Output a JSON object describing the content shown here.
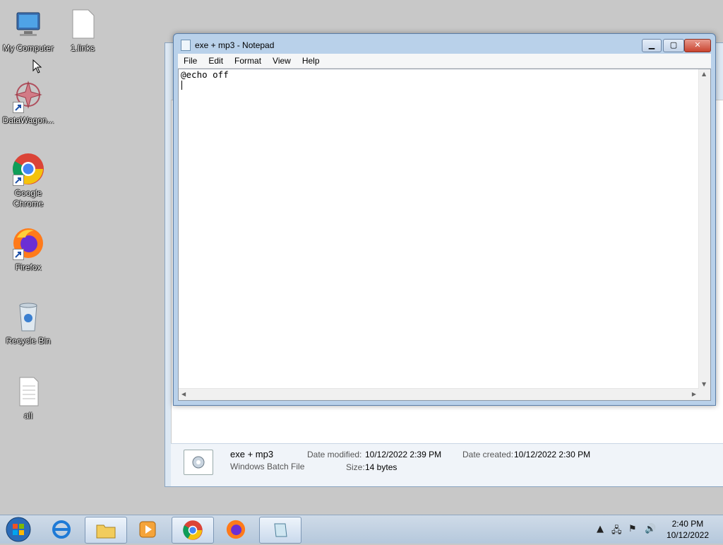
{
  "desktop": {
    "icons": [
      {
        "label": "My Computer"
      },
      {
        "label": "1.links"
      },
      {
        "label": "DataWagon..."
      },
      {
        "label": "Google Chrome"
      },
      {
        "label": "Firefox"
      },
      {
        "label": "Recycle Bin"
      },
      {
        "label": "all"
      }
    ]
  },
  "notepad": {
    "title": "exe + mp3 - Notepad",
    "menu": [
      "File",
      "Edit",
      "Format",
      "View",
      "Help"
    ],
    "content": "@echo off",
    "buttons": {
      "minimize": "▁",
      "maximize": "▢",
      "close": "✕"
    }
  },
  "explorer_details": {
    "file_name": "exe + mp3",
    "file_type": "Windows Batch File",
    "date_modified_label": "Date modified:",
    "date_modified": "10/12/2022 2:39 PM",
    "date_created_label": "Date created:",
    "date_created": "10/12/2022 2:30 PM",
    "size_label": "Size:",
    "size": "14 bytes"
  },
  "taskbar": {
    "time": "2:40 PM",
    "date": "10/12/2022"
  }
}
